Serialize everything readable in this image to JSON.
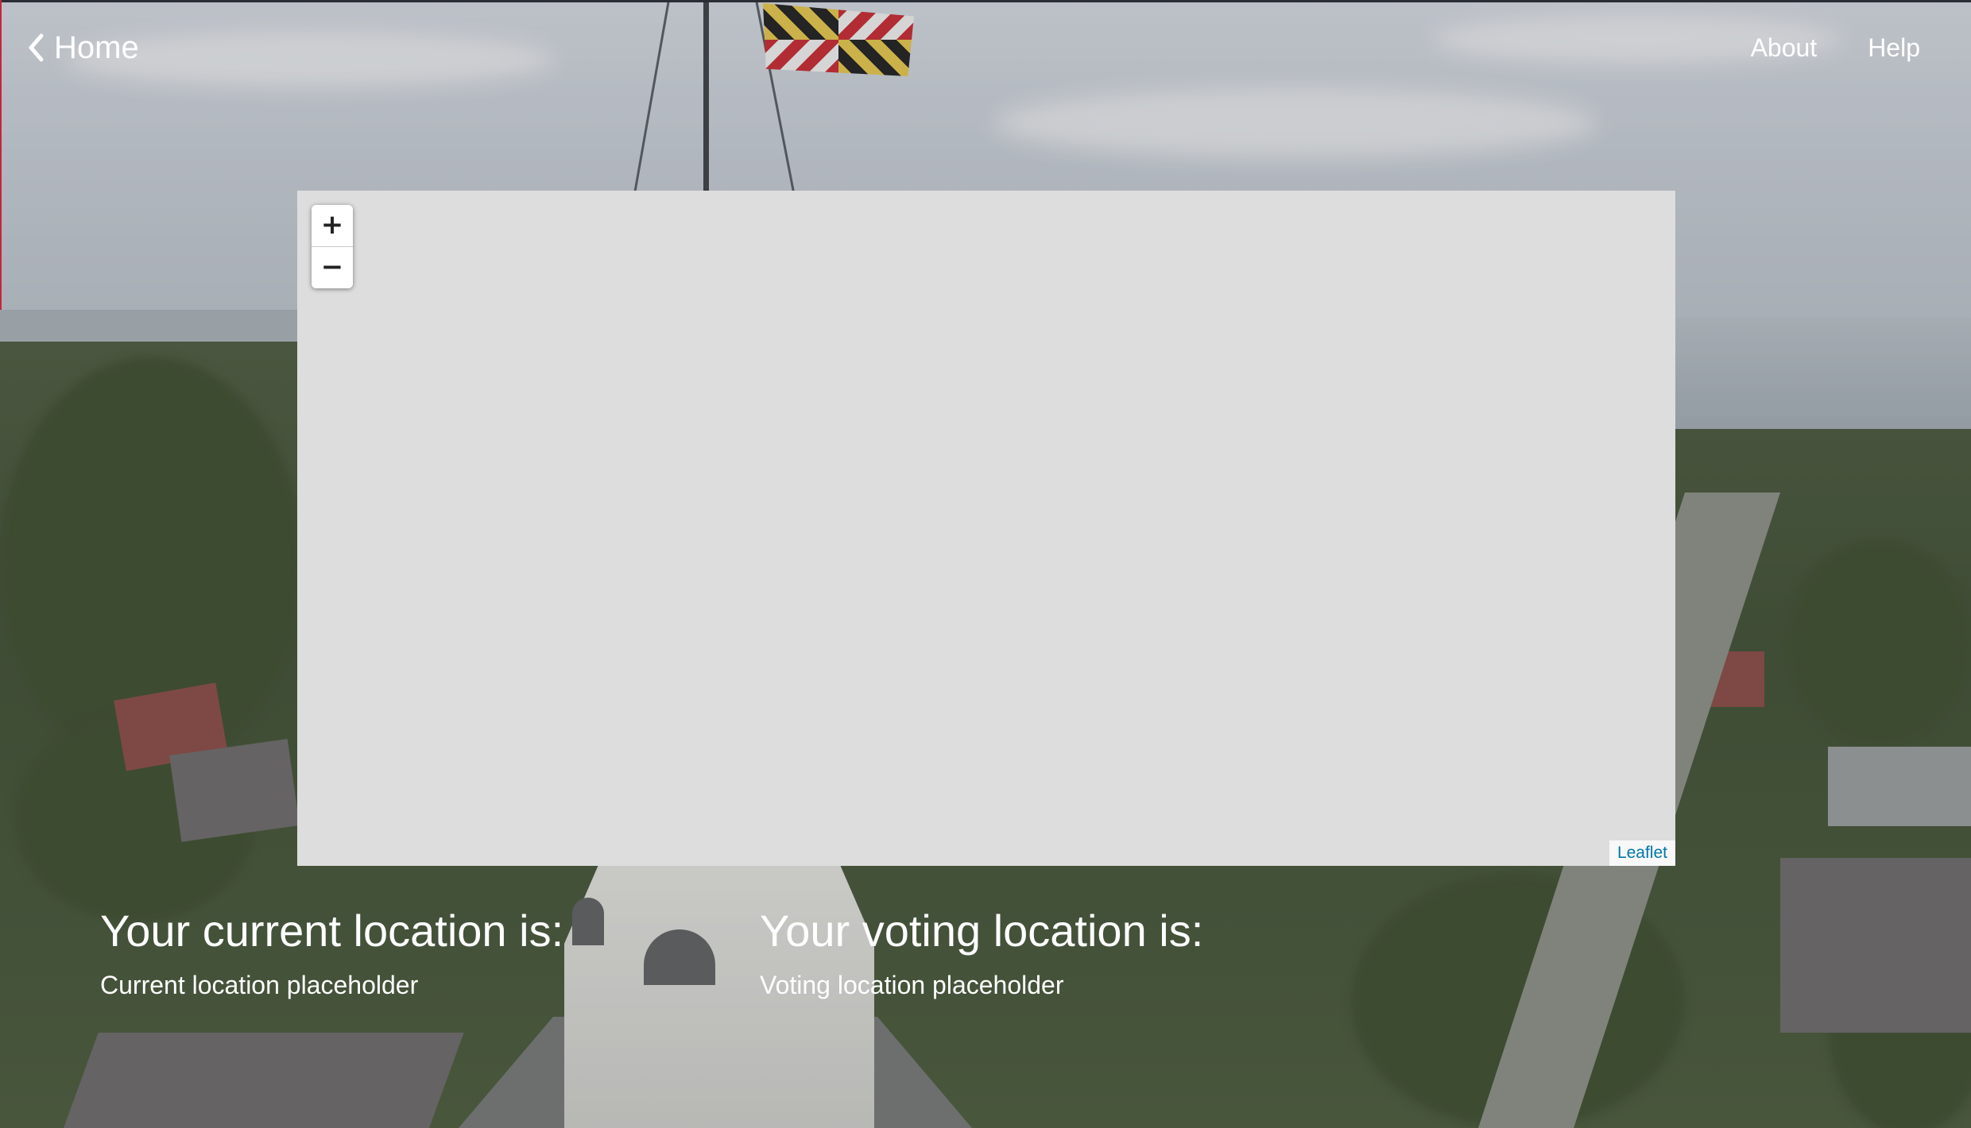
{
  "nav": {
    "home_label": "Home",
    "home_icon": "chevron-left-icon",
    "about_label": "About",
    "help_label": "Help"
  },
  "map": {
    "zoom_in_label": "+",
    "zoom_out_label": "−",
    "attribution": "Leaflet",
    "attribution_color": "#0078a8",
    "tile_background": "#dddddd"
  },
  "current_location": {
    "heading": "Your current location is:",
    "value": "Current location placeholder"
  },
  "voting_location": {
    "heading": "Your voting location is:",
    "value": "Voting location placeholder"
  },
  "colors": {
    "text": "#ffffff",
    "accent_edge": "#c2273a"
  }
}
